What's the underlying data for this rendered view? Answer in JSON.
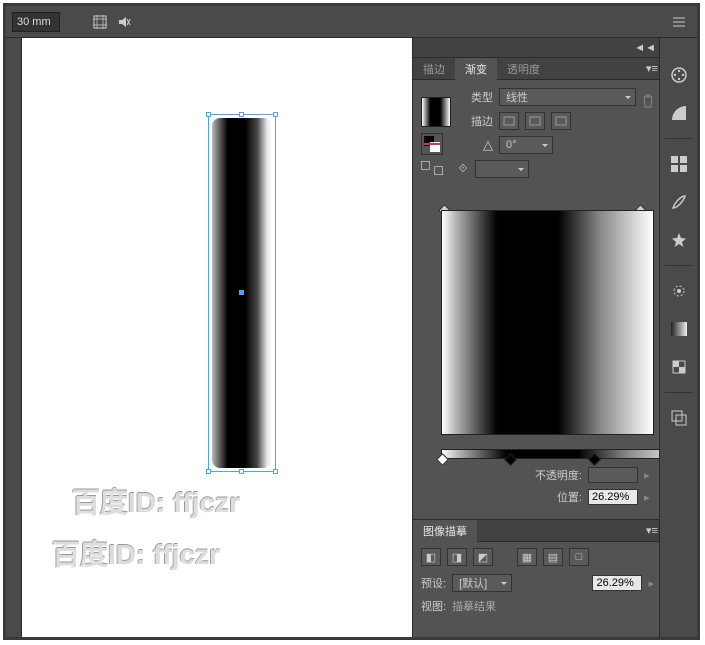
{
  "topbar": {
    "size_value": "30 mm"
  },
  "panel_tabs": {
    "stroke": "描边",
    "gradient": "渐变",
    "opacity": "透明度"
  },
  "gradient_panel": {
    "type_label": "类型",
    "type_value": "线性",
    "stroke_label": "描边",
    "angle_value": "0°",
    "opacity_label": "不透明度:",
    "location_label": "位置:",
    "location_value": "26.29%"
  },
  "image_trace": {
    "title": "图像描摹",
    "preset_label": "预设:",
    "preset_value": "[默认]",
    "slider_value": "26.29%",
    "view_label": "视图:",
    "view_value": "描摹结果"
  },
  "watermark": {
    "line1": "百度ID: ffjczr",
    "line2": "百度ID: ffjczr"
  },
  "chart_data": {
    "type": "other",
    "note": "Illustrator gradient editor UI — gradient stops along a 0–100% ramp",
    "stops": [
      {
        "position": 0,
        "color": "#ffffff"
      },
      {
        "position": 26.29,
        "color": "#000000"
      },
      {
        "position": 60,
        "color": "#000000"
      },
      {
        "position": 100,
        "color": "#ffffff"
      }
    ],
    "angle": 0,
    "gradient_type": "线性"
  }
}
